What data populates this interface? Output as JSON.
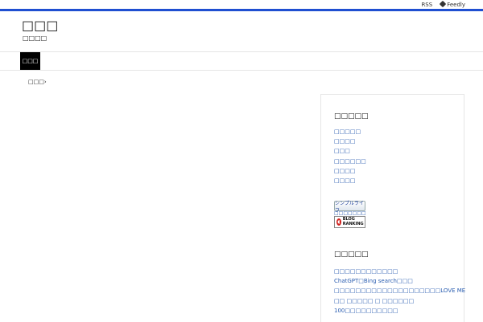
{
  "topbar": {
    "rss": "RSS",
    "feedly": "Feedly"
  },
  "site": {
    "title": "□□□",
    "description": "□□□□"
  },
  "nav": {
    "items": [
      {
        "label": "□□□"
      }
    ]
  },
  "breadcrumb": "□□□›",
  "sidebar": {
    "categories": {
      "title": "□□□□□",
      "items": [
        "□□□□□",
        "□□□□",
        "□□□",
        "□□□□□□",
        "□□□□",
        "□□□□"
      ]
    },
    "banners": {
      "simple": "シンプルライフ",
      "simple_caption": "□□□□□□□",
      "blog_ranking": "BLOG RANKING"
    },
    "recent": {
      "title": "□□□□□",
      "items": [
        "□□□□□□□□□□□□",
        "ChatGPT□Bing search□□□",
        "□□□□□□□□□□□□□□□□□□□□LOVE ME",
        "□□ □□□□□ □ □□□□□□",
        "100□□□□□□□□□□"
      ]
    }
  }
}
